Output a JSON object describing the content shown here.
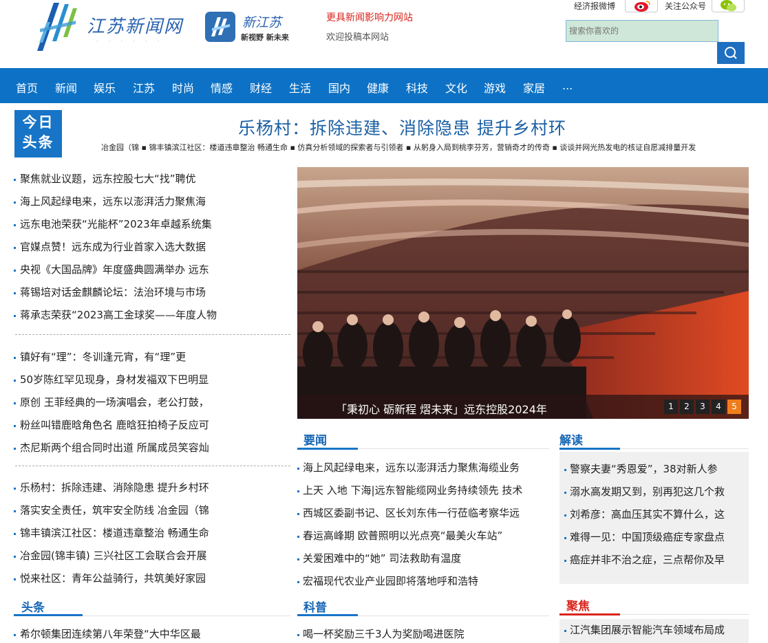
{
  "header": {
    "logo_text": "江苏新闻网",
    "xjs_title": "新江苏",
    "xjs_slogan": "新视野 新未来",
    "tagline": "更具新闻影响力网站",
    "contribute": "欢迎投稿本网站",
    "weibo_label": "经济报微博",
    "wechat_label": "关注公众号",
    "search_placeholder": "搜索你喜欢的"
  },
  "nav": {
    "items": [
      "首页",
      "新闻",
      "娱乐",
      "江苏",
      "时尚",
      "情感",
      "财经",
      "生活",
      "国内",
      "健康",
      "科技",
      "文化",
      "游戏",
      "家居",
      "..."
    ]
  },
  "today": {
    "badge_line1": "今日",
    "badge_line2": "头条",
    "headline": "乐杨村：拆除违建、消除隐患 提升乡村环",
    "ticker": "冶金园（锦 ▪ 锦丰镇滨江社区：楼道违章整治 畅通生命 ▪ 仿真分析领域的探索者与引领者 ▪ 从躬身入局到桃李芬芳，营销奇才的传奇 ▪ 谈谈并网光热发电的核证自愿减排量开发"
  },
  "left_list": {
    "group1": [
      "聚焦就业议题，远东控股七大“找”聘优",
      "海上风起绿电来，远东以澎湃活力聚焦海",
      "远东电池荣获“光能杯”2023年卓越系统集",
      "官媒点赞！远东成为行业首家入选大数据",
      "央视《大国品牌》年度盛典圆满举办 远东",
      "蒋锡培对话金麒麟论坛：法治环境与市场",
      "蒋承志荣获“2023高工金球奖——年度人物"
    ],
    "group2": [
      "镇好有“理”：冬训逢元宵，有“理”更",
      "50岁陈红罕见现身，身材发福双下巴明显",
      "原创 王菲经典的一场演唱会，老公打鼓，",
      "粉丝叫错鹿晗角色名 鹿晗狂拍椅子反应可",
      "杰尼斯两个组合同时出道 所属成员笑容灿"
    ],
    "group3": [
      "乐杨村：拆除违建、消除隐患 提升乡村环",
      "落实安全责任，筑牢安全防线 冶金园（锦",
      "锦丰镇滨江社区：楼道违章整治 畅通生命",
      "冶金园(锦丰镇) 三兴社区工会联合会开展",
      "悦来社区：青年公益骑行，共筑美好家园"
    ]
  },
  "slider": {
    "caption": "「秉初心 砺新程 熠未来」远东控股2024年",
    "pages": [
      "1",
      "2",
      "3",
      "4",
      "5"
    ],
    "active_page": "5"
  },
  "sections": {
    "yaowen": {
      "title": "要闻",
      "items": [
        "海上风起绿电来，远东以澎湃活力聚焦海缆业务",
        "上天 入地 下海|远东智能缆网业务持续领先 技术",
        "西城区委副书记、区长刘东伟一行莅临考察华远",
        "春运高峰期 欧普照明以光点亮“最美火车站”",
        "关爱困难中的“她” 司法救助有温度",
        "宏福现代农业产业园即将落地呼和浩特"
      ]
    },
    "jiedu": {
      "title": "解读",
      "items": [
        "警察夫妻“秀恩爱”，38对新人参",
        "溺水高发期又到，别再犯这几个救",
        "刘希彦：高血压其实不算什么，这",
        "难得一见：中国顶级癌症专家盘点",
        "癌症并非不治之症，三点帮你及早"
      ]
    },
    "toutiao": {
      "title": "头条",
      "items": [
        "希尔顿集团连续第八年荣登“大中华区最"
      ]
    },
    "kepu": {
      "title": "科普",
      "items": [
        "喝一杯奖励三千3人为奖励喝进医院"
      ]
    },
    "jujiao": {
      "title": "聚焦",
      "items": [
        "江汽集团展示智能汽车领域布局成"
      ]
    }
  },
  "colors": {
    "nav_blue": "#0d72c5",
    "accent_red": "#d9241c",
    "active_orange": "#f07d1c"
  }
}
